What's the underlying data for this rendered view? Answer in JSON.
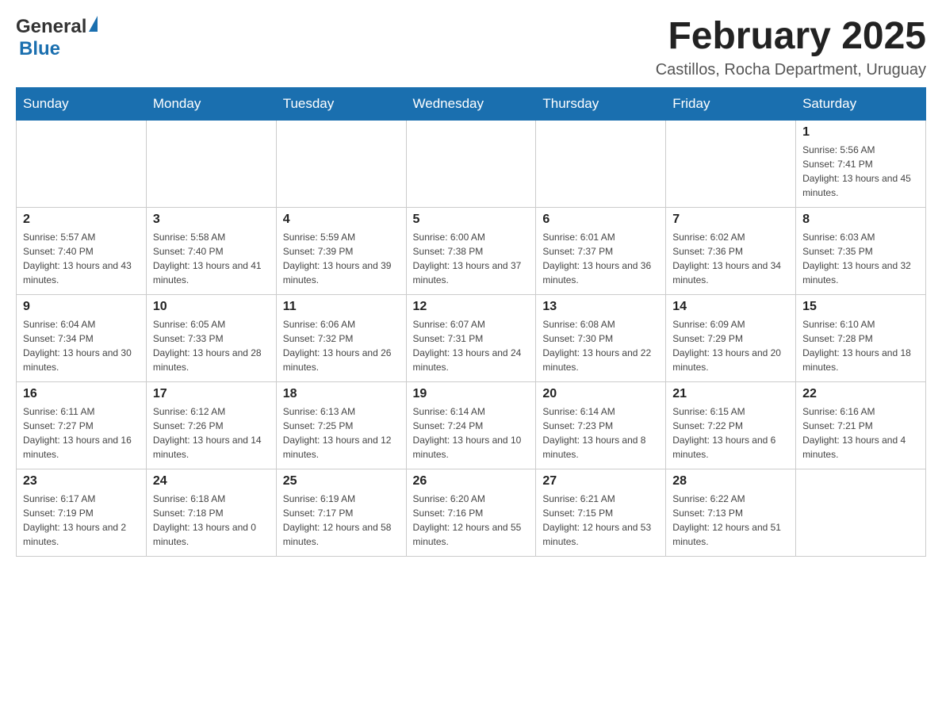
{
  "logo": {
    "general": "General",
    "blue": "Blue"
  },
  "header": {
    "month_title": "February 2025",
    "location": "Castillos, Rocha Department, Uruguay"
  },
  "days_of_week": [
    "Sunday",
    "Monday",
    "Tuesday",
    "Wednesday",
    "Thursday",
    "Friday",
    "Saturday"
  ],
  "weeks": [
    [
      {
        "day": "",
        "info": ""
      },
      {
        "day": "",
        "info": ""
      },
      {
        "day": "",
        "info": ""
      },
      {
        "day": "",
        "info": ""
      },
      {
        "day": "",
        "info": ""
      },
      {
        "day": "",
        "info": ""
      },
      {
        "day": "1",
        "info": "Sunrise: 5:56 AM\nSunset: 7:41 PM\nDaylight: 13 hours and 45 minutes."
      }
    ],
    [
      {
        "day": "2",
        "info": "Sunrise: 5:57 AM\nSunset: 7:40 PM\nDaylight: 13 hours and 43 minutes."
      },
      {
        "day": "3",
        "info": "Sunrise: 5:58 AM\nSunset: 7:40 PM\nDaylight: 13 hours and 41 minutes."
      },
      {
        "day": "4",
        "info": "Sunrise: 5:59 AM\nSunset: 7:39 PM\nDaylight: 13 hours and 39 minutes."
      },
      {
        "day": "5",
        "info": "Sunrise: 6:00 AM\nSunset: 7:38 PM\nDaylight: 13 hours and 37 minutes."
      },
      {
        "day": "6",
        "info": "Sunrise: 6:01 AM\nSunset: 7:37 PM\nDaylight: 13 hours and 36 minutes."
      },
      {
        "day": "7",
        "info": "Sunrise: 6:02 AM\nSunset: 7:36 PM\nDaylight: 13 hours and 34 minutes."
      },
      {
        "day": "8",
        "info": "Sunrise: 6:03 AM\nSunset: 7:35 PM\nDaylight: 13 hours and 32 minutes."
      }
    ],
    [
      {
        "day": "9",
        "info": "Sunrise: 6:04 AM\nSunset: 7:34 PM\nDaylight: 13 hours and 30 minutes."
      },
      {
        "day": "10",
        "info": "Sunrise: 6:05 AM\nSunset: 7:33 PM\nDaylight: 13 hours and 28 minutes."
      },
      {
        "day": "11",
        "info": "Sunrise: 6:06 AM\nSunset: 7:32 PM\nDaylight: 13 hours and 26 minutes."
      },
      {
        "day": "12",
        "info": "Sunrise: 6:07 AM\nSunset: 7:31 PM\nDaylight: 13 hours and 24 minutes."
      },
      {
        "day": "13",
        "info": "Sunrise: 6:08 AM\nSunset: 7:30 PM\nDaylight: 13 hours and 22 minutes."
      },
      {
        "day": "14",
        "info": "Sunrise: 6:09 AM\nSunset: 7:29 PM\nDaylight: 13 hours and 20 minutes."
      },
      {
        "day": "15",
        "info": "Sunrise: 6:10 AM\nSunset: 7:28 PM\nDaylight: 13 hours and 18 minutes."
      }
    ],
    [
      {
        "day": "16",
        "info": "Sunrise: 6:11 AM\nSunset: 7:27 PM\nDaylight: 13 hours and 16 minutes."
      },
      {
        "day": "17",
        "info": "Sunrise: 6:12 AM\nSunset: 7:26 PM\nDaylight: 13 hours and 14 minutes."
      },
      {
        "day": "18",
        "info": "Sunrise: 6:13 AM\nSunset: 7:25 PM\nDaylight: 13 hours and 12 minutes."
      },
      {
        "day": "19",
        "info": "Sunrise: 6:14 AM\nSunset: 7:24 PM\nDaylight: 13 hours and 10 minutes."
      },
      {
        "day": "20",
        "info": "Sunrise: 6:14 AM\nSunset: 7:23 PM\nDaylight: 13 hours and 8 minutes."
      },
      {
        "day": "21",
        "info": "Sunrise: 6:15 AM\nSunset: 7:22 PM\nDaylight: 13 hours and 6 minutes."
      },
      {
        "day": "22",
        "info": "Sunrise: 6:16 AM\nSunset: 7:21 PM\nDaylight: 13 hours and 4 minutes."
      }
    ],
    [
      {
        "day": "23",
        "info": "Sunrise: 6:17 AM\nSunset: 7:19 PM\nDaylight: 13 hours and 2 minutes."
      },
      {
        "day": "24",
        "info": "Sunrise: 6:18 AM\nSunset: 7:18 PM\nDaylight: 13 hours and 0 minutes."
      },
      {
        "day": "25",
        "info": "Sunrise: 6:19 AM\nSunset: 7:17 PM\nDaylight: 12 hours and 58 minutes."
      },
      {
        "day": "26",
        "info": "Sunrise: 6:20 AM\nSunset: 7:16 PM\nDaylight: 12 hours and 55 minutes."
      },
      {
        "day": "27",
        "info": "Sunrise: 6:21 AM\nSunset: 7:15 PM\nDaylight: 12 hours and 53 minutes."
      },
      {
        "day": "28",
        "info": "Sunrise: 6:22 AM\nSunset: 7:13 PM\nDaylight: 12 hours and 51 minutes."
      },
      {
        "day": "",
        "info": ""
      }
    ]
  ]
}
